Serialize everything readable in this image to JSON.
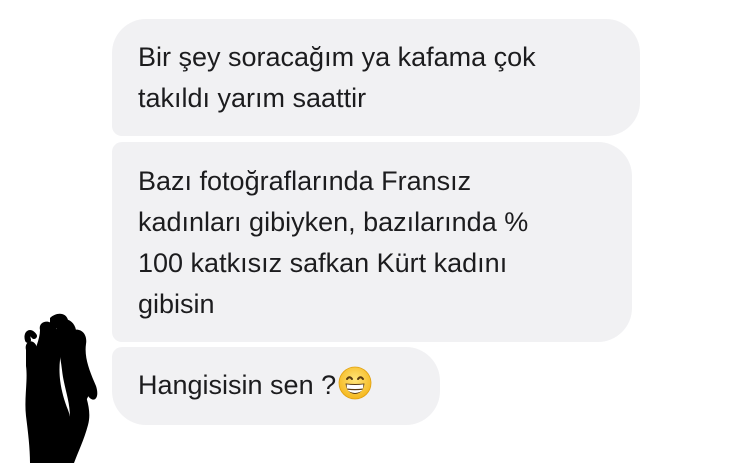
{
  "messages": [
    {
      "lines": [
        "Bir şey soracağım ya kafama çok",
        "takıldı yarım saattir"
      ]
    },
    {
      "lines": [
        "Bazı fotoğraflarında Fransız",
        "kadınları gibiyken, bazılarında %",
        "100 katkısız safkan Kürt kadını",
        "gibisin"
      ]
    },
    {
      "text": "Hangisisin sen ?",
      "emoji": "grinning-face-with-smiling-eyes-icon"
    }
  ],
  "colors": {
    "bubble_bg": "#f1f1f3",
    "text": "#1c1c1e",
    "redaction": "#000000"
  }
}
